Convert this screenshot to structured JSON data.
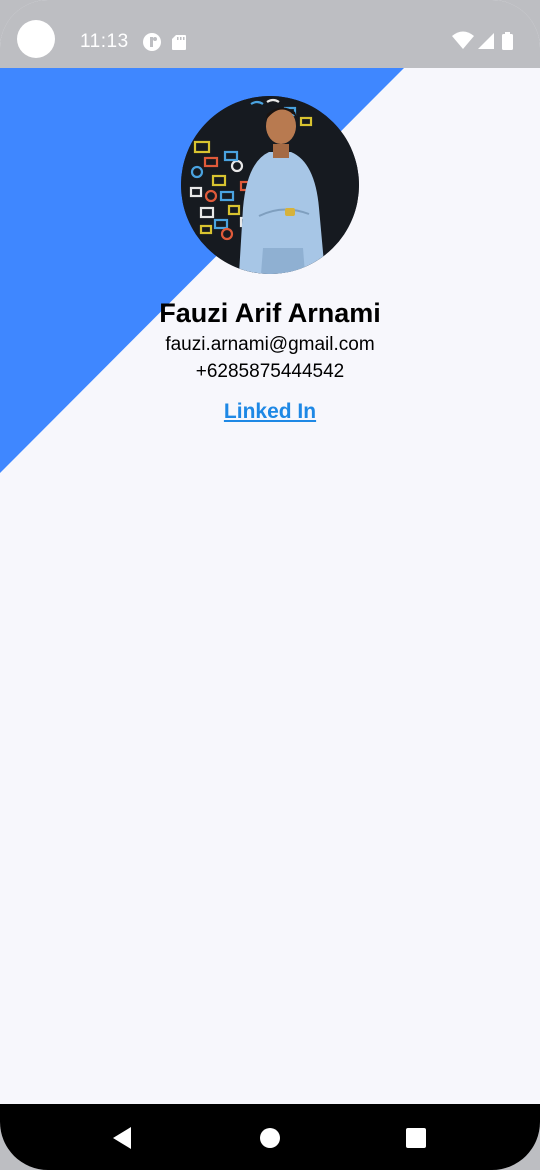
{
  "status_bar": {
    "time": "11:13",
    "left_icons": [
      "notification-app-icon",
      "sd-card-icon"
    ],
    "right_icons": [
      "wifi-icon",
      "signal-icon",
      "battery-icon"
    ]
  },
  "profile": {
    "name": "Fauzi Arif Arnami",
    "email": "fauzi.arnami@gmail.com",
    "phone": "+6285875444542",
    "link_label": "Linked In"
  },
  "colors": {
    "accent_blue": "#3f87ff",
    "background": "#f7f7fc",
    "link": "#1e88e5",
    "status_bar": "#bdbec2"
  },
  "nav_bar": {
    "buttons": [
      "back-icon",
      "home-icon",
      "recents-icon"
    ]
  }
}
